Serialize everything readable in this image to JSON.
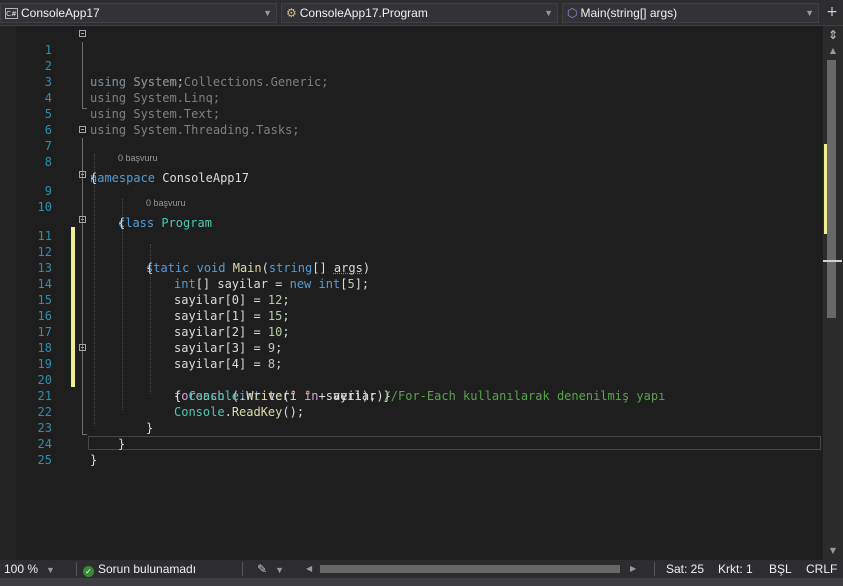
{
  "navbar": {
    "project_combo": {
      "icon": "csharp-project-icon",
      "icon_text": "C#",
      "label": "ConsoleApp17"
    },
    "type_combo": {
      "icon": "class-icon",
      "label": "ConsoleApp17.Program"
    },
    "member_combo": {
      "icon": "method-icon",
      "label": "Main(string[] args)"
    },
    "add_button_icon": "plus-icon"
  },
  "editor": {
    "codelens_text": "0 başvuru",
    "lines": [
      {
        "num": "1"
      },
      {
        "num": "2"
      },
      {
        "num": "3"
      },
      {
        "num": "4"
      },
      {
        "num": "5"
      },
      {
        "num": "6"
      },
      {
        "num": "7"
      },
      {
        "num": "8"
      },
      {
        "num": "9"
      },
      {
        "num": "10"
      },
      {
        "num": "11"
      },
      {
        "num": "12"
      },
      {
        "num": "13"
      },
      {
        "num": "14"
      },
      {
        "num": "15"
      },
      {
        "num": "16"
      },
      {
        "num": "17"
      },
      {
        "num": "18"
      },
      {
        "num": "19"
      },
      {
        "num": "20"
      },
      {
        "num": "21"
      },
      {
        "num": "22"
      },
      {
        "num": "23"
      },
      {
        "num": "24"
      },
      {
        "num": "25"
      }
    ],
    "tokens": {
      "kw_using": "using",
      "ns_system": "System;",
      "ns_collections": "System.Collections.Generic;",
      "ns_linq": "System.Linq;",
      "ns_text": "System.Text;",
      "ns_tasks": "System.Threading.Tasks;",
      "kw_namespace": "namespace",
      "namespace_name": "ConsoleApp17",
      "open_brace": "{",
      "close_brace": "}",
      "kw_class": "class",
      "class_name": "Program",
      "kw_static": "static",
      "kw_void": "void",
      "method_name": "Main",
      "paren_open": "(",
      "kw_string": "string",
      "array_bracket": "[] ",
      "param_args": "args",
      "paren_close": ")",
      "kw_int": "int",
      "array_decl": "[] sayilar = ",
      "kw_new": "new",
      "array_size": "[",
      "num_5": "5",
      "end_bracket_semicolon": "];",
      "assign_0": "sayilar[0] = ",
      "num_12": "12",
      "assign_1": "sayilar[1] = ",
      "num_15": "15",
      "assign_2": "sayilar[2] = ",
      "num_10": "10",
      "assign_3": "sayilar[3] = ",
      "num_9": "9",
      "assign_4": "sayilar[4] = ",
      "num_8": "8",
      "semicolon": ";",
      "kw_foreach": "foreach",
      "foreach_open": " (",
      "foreach_var": " veri ",
      "kw_in": "in",
      "foreach_coll": " sayilar)",
      "comment": "//For-Each kullanılarak denenilmiş yapı",
      "brace_space": "{ ",
      "type_console": "Console",
      "dot": ".",
      "method_write": "Write",
      "str_space": "\" \"",
      "plus_veri": " + veri); }",
      "method_readkey": "ReadKey",
      "call_end": "();"
    }
  },
  "statusbar": {
    "zoom": "100 %",
    "issues_icon": "check-circle-icon",
    "issues": "Sorun bulunamadı",
    "filter_icon": "brush-icon",
    "line": "Sat: 25",
    "column": "Krkt: 1",
    "mode": "BŞL",
    "line_ending": "CRLF"
  }
}
